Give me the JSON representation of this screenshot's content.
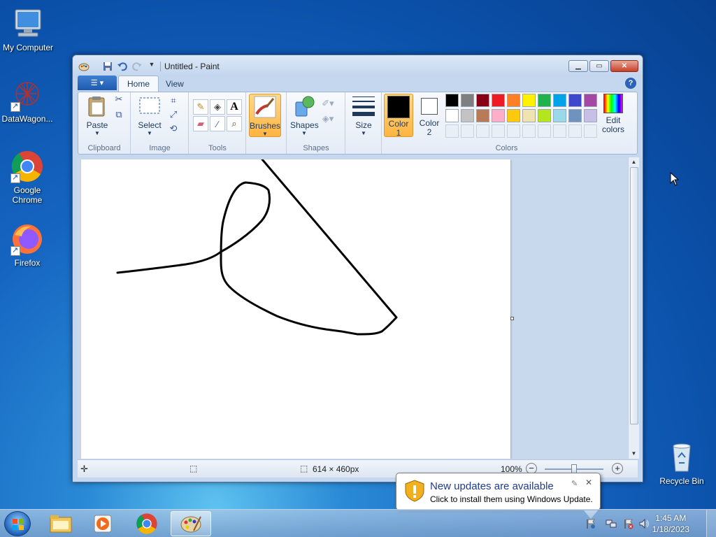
{
  "desktop": {
    "icons": [
      {
        "label": "My Computer",
        "icon": "computer-icon"
      },
      {
        "label": "DataWagon...",
        "icon": "datawagon-icon"
      },
      {
        "label": "Google Chrome",
        "icon": "chrome-icon"
      },
      {
        "label": "Firefox",
        "icon": "firefox-icon"
      },
      {
        "label": "Recycle Bin",
        "icon": "recycle-bin-icon"
      }
    ]
  },
  "window": {
    "title": "Untitled - Paint",
    "tabs": [
      {
        "label": "Home",
        "active": true
      },
      {
        "label": "View",
        "active": false
      }
    ],
    "ribbon": {
      "clipboard": {
        "label": "Clipboard",
        "paste": "Paste"
      },
      "image": {
        "label": "Image",
        "select": "Select"
      },
      "tools": {
        "label": "Tools"
      },
      "brushes": {
        "label": "Brushes"
      },
      "shapes": {
        "label": "Shapes",
        "shapes_btn": "Shapes"
      },
      "size": {
        "label": "Size"
      },
      "colors": {
        "label": "Colors",
        "color1_line1": "Color",
        "color1_line2": "1",
        "color2_line1": "Color",
        "color2_line2": "2",
        "edit_line1": "Edit",
        "edit_line2": "colors",
        "color1": "#000000",
        "color2": "#ffffff",
        "palette_row1": [
          "#000000",
          "#7f7f7f",
          "#880015",
          "#ed1c24",
          "#ff7f27",
          "#fff200",
          "#22b14c",
          "#00a2e8",
          "#3f48cc",
          "#a349a4"
        ],
        "palette_row2": [
          "#ffffff",
          "#c3c3c3",
          "#b97a57",
          "#ffaec9",
          "#ffc90e",
          "#efe4b0",
          "#b5e61d",
          "#99d9ea",
          "#7092be",
          "#c8bfe7"
        ]
      }
    },
    "status": {
      "canvas_size": "614 × 460px",
      "zoom": "100%"
    }
  },
  "notification": {
    "title": "New updates are available",
    "body": "Click to install them using Windows Update."
  },
  "taskbar": {
    "time": "1:45 AM",
    "date": "1/18/2023"
  }
}
